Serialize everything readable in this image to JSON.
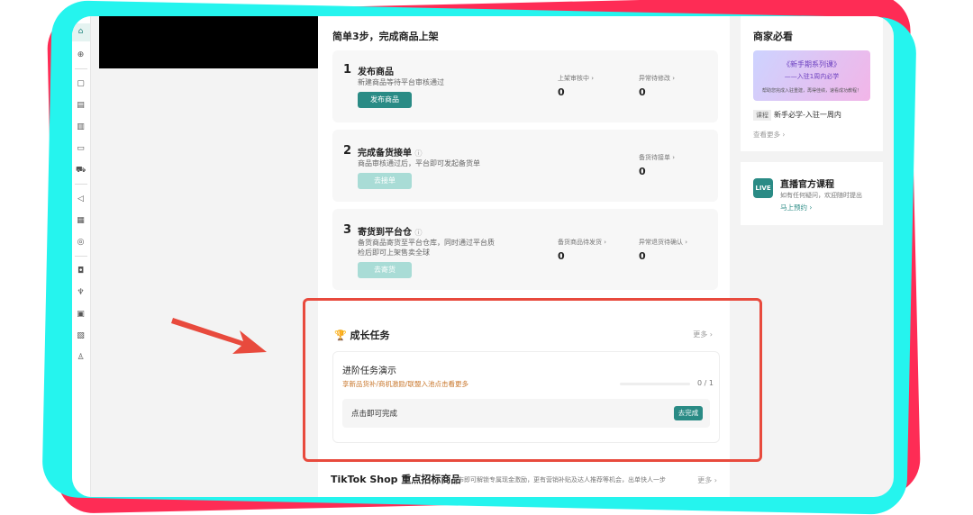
{
  "header": "简单3步，完成商品上架",
  "steps": [
    {
      "num": "1",
      "title": "发布商品",
      "desc": "新建商品等待平台审核通过",
      "button": "发布商品",
      "stats": [
        {
          "label": "上架审核中 ›",
          "value": "0"
        },
        {
          "label": "异常待修改 ›",
          "value": "0"
        }
      ]
    },
    {
      "num": "2",
      "title": "完成备货接单",
      "desc": "商品审核通过后，平台即可发起备货单",
      "button": "去接单",
      "stats": [
        {
          "label": "备货待接单 ›",
          "value": "0"
        }
      ]
    },
    {
      "num": "3",
      "title": "寄货到平台仓",
      "desc1": "备货商品寄货至平台仓库，同时通过平台质",
      "desc2": "检后即可上架售卖全球",
      "button": "去寄货",
      "stats": [
        {
          "label": "备货商品待发货 ›",
          "value": "0"
        },
        {
          "label": "异常退货待确认 ›",
          "value": "0"
        }
      ]
    }
  ],
  "growth": {
    "title": "成长任务",
    "more": "更多 ›",
    "task_title": "进阶任务演示",
    "task_desc": "享新品货补/商机激励/联盟入池点击看更多",
    "progress_text": "0 / 1",
    "progress": 0,
    "item": "点击即可完成",
    "go": "去完成"
  },
  "bottom": {
    "title": "TikTok Shop 重点招标商品",
    "desc": "发布即可解锁专属现金激励，更有营销补贴及达人推荐等机会，出单快人一步",
    "more": "更多 ›"
  },
  "right1": {
    "title": "商家必看",
    "banner1": "《新手期系列课》",
    "banner2": "——入驻1周内必学",
    "banner3": "帮助您完成入驻重建，再得佳绩，速看成功教程！",
    "tag": "课程",
    "course": "新手必学-入驻一周内",
    "more": "查看更多 ›"
  },
  "right2": {
    "title": "直播官方课程",
    "desc": "如有任何疑问，欢迎随时提出",
    "action": "马上预约 ›",
    "badge": "LIVE"
  },
  "colors": {
    "accent": "#2a8b85",
    "highlight": "#e84a3d",
    "frame_red": "#fe2c55",
    "frame_cyan": "#25f4ee"
  }
}
